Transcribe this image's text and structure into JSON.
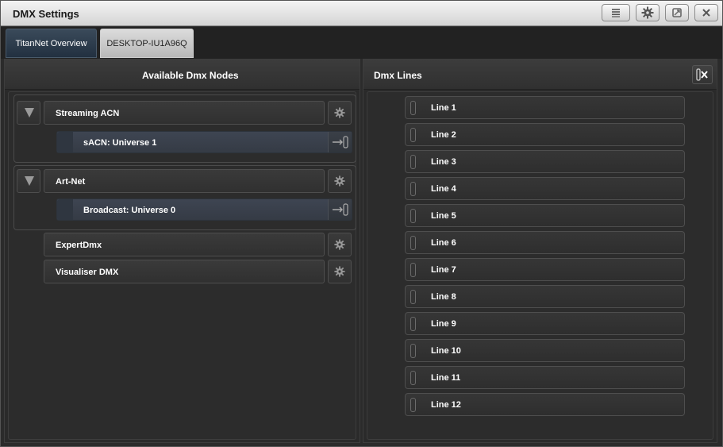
{
  "window": {
    "title": "DMX Settings"
  },
  "titlebar_icons": [
    "menu-lines-icon",
    "gear-icon",
    "restore-window-icon",
    "close-icon"
  ],
  "tabs": [
    {
      "label": "TitanNet Overview",
      "active": false
    },
    {
      "label": "DESKTOP-IU1A96Q",
      "active": true
    }
  ],
  "left_panel": {
    "title": "Available Dmx Nodes",
    "groups": [
      {
        "name": "Streaming ACN",
        "expanded": true,
        "universes": [
          "sACN: Universe 1"
        ]
      },
      {
        "name": "Art-Net",
        "expanded": true,
        "universes": [
          "Broadcast: Universe 0"
        ]
      }
    ],
    "nodes": [
      {
        "name": "ExpertDmx"
      },
      {
        "name": "Visualiser DMX"
      }
    ]
  },
  "right_panel": {
    "title": "Dmx Lines",
    "lines": [
      "Line 1",
      "Line 2",
      "Line 3",
      "Line 4",
      "Line 5",
      "Line 6",
      "Line 7",
      "Line 8",
      "Line 9",
      "Line 10",
      "Line 11",
      "Line 12"
    ]
  },
  "colors": {
    "background": "#2b2b2b",
    "title_bar": "#dcdcdc",
    "active_tab": "#c8c8c8",
    "inactive_tab": "#2c3a4a",
    "universe_bar": "#3a414c"
  }
}
